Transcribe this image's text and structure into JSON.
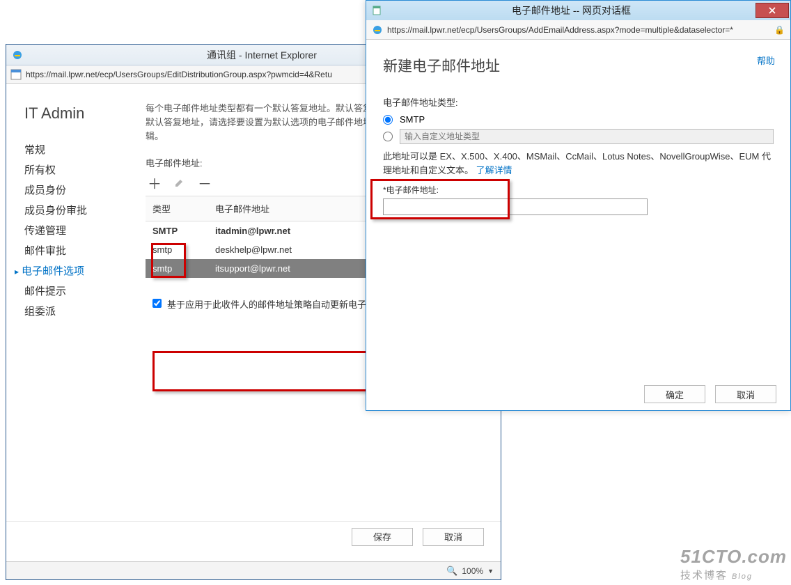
{
  "backWindow": {
    "title": "通讯组 - Internet Explorer",
    "url": "https://mail.lpwr.net/ecp/UsersGroups/EditDistributionGroup.aspx?pwmcid=4&Retu",
    "groupTitle": "IT Admin",
    "nav": [
      "常规",
      "所有权",
      "成员身份",
      "成员身份审批",
      "传递管理",
      "邮件审批",
      "电子邮件选项",
      "邮件提示",
      "组委派"
    ],
    "navSelected": "电子邮件选项",
    "infoText": "每个电子邮件地址类型都有一个默认答复地址。默认答复地址以粗体显示。若要更改默认答复地址，请选择要设置为默认选项的电子邮件地址，然后双击以对其进行编辑。",
    "sectionLabel": "电子邮件地址:",
    "tableHeaders": {
      "type": "类型",
      "addr": "电子邮件地址"
    },
    "rows": [
      {
        "type": "SMTP",
        "addr": "itadmin@lpwr.net",
        "bold": true,
        "sel": false
      },
      {
        "type": "smtp",
        "addr": "deskhelp@lpwr.net",
        "bold": false,
        "sel": false
      },
      {
        "type": "smtp",
        "addr": "itsupport@lpwr.net",
        "bold": false,
        "sel": true
      }
    ],
    "checkboxLabel": "基于应用于此收件人的邮件地址策略自动更新电子邮件地址",
    "saveBtn": "保存",
    "cancelBtn": "取消",
    "zoom": "100%"
  },
  "frontWindow": {
    "title": "电子邮件地址 -- 网页对话框",
    "url": "https://mail.lpwr.net/ecp/UsersGroups/AddEmailAddress.aspx?mode=multiple&dataselector=*",
    "helpLink": "帮助",
    "heading": "新建电子邮件地址",
    "typeLabel": "电子邮件地址类型:",
    "smtpLabel": "SMTP",
    "customPlaceholder": "输入自定义地址类型",
    "hintPrefix": "此地址可以是 EX、X.500、X.400、MSMail、CcMail、Lotus Notes、NovellGroupWise、EUM 代理地址和自定义文本。",
    "learnMore": "了解详情",
    "emailLabel": "*电子邮件地址:",
    "okBtn": "确定",
    "cancelBtn": "取消"
  },
  "watermark": {
    "big": "51CTO.com",
    "cn": "技术博客",
    "en": "Blog"
  }
}
